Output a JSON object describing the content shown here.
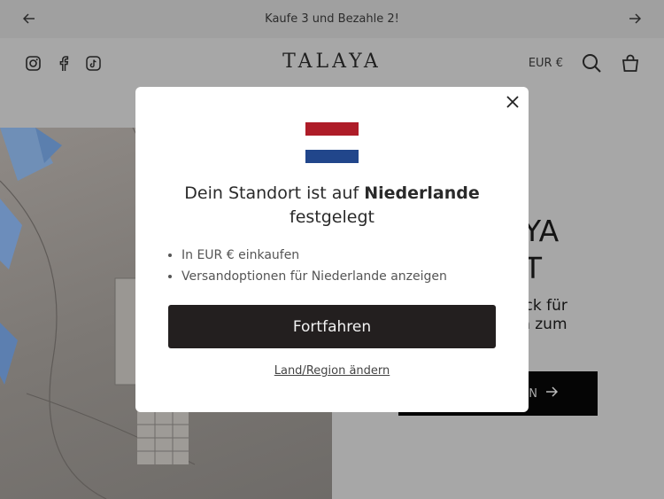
{
  "announcement": {
    "text": "Kaufe 3 und Bezahle 2!"
  },
  "header": {
    "logo": "TALAYA",
    "currency": "EUR €"
  },
  "hero": {
    "title_partial_1": "AYA",
    "title_partial_2": "ET",
    "subtitle_partial_1": "huck für",
    "subtitle_partial_2": "ren zum",
    "subtitle_partial_3": "!",
    "button_partial": "EN"
  },
  "modal": {
    "title_prefix": "Dein Standort ist auf",
    "title_country": "Niederlande",
    "title_suffix": "festgelegt",
    "bullets": [
      "In EUR € einkaufen",
      "Versandoptionen für Niederlande anzeigen"
    ],
    "continue_button": "Fortfahren",
    "change_region_link": "Land/Region ändern",
    "flag_colors": [
      "#ae1c28",
      "#ffffff",
      "#21468b"
    ]
  }
}
